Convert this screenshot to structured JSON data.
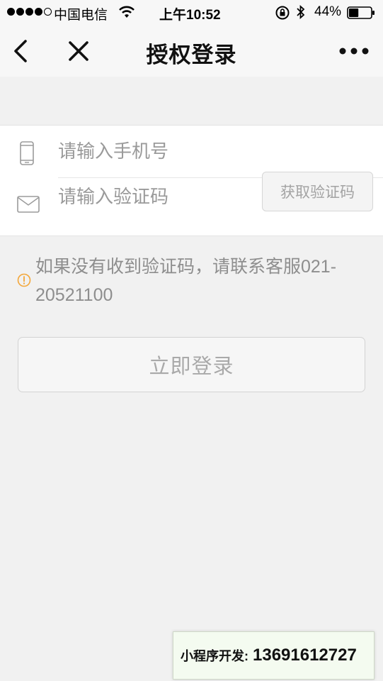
{
  "status_bar": {
    "carrier": "中国电信",
    "time": "上午10:52",
    "battery": "44%",
    "battery_level": 0.44
  },
  "nav": {
    "title": "授权登录",
    "back_icon": "chevron-left-icon",
    "close_icon": "close-icon",
    "more_icon": "more-dots-icon"
  },
  "form": {
    "phone": {
      "placeholder": "请输入手机号",
      "value": "",
      "icon": "phone-icon"
    },
    "code": {
      "placeholder": "请输入验证码",
      "value": "",
      "icon": "mail-icon"
    },
    "get_code_label": "获取验证码"
  },
  "tip": {
    "text": "如果没有收到验证码，请联系客服021-20521100",
    "icon": "warning-icon",
    "icon_color": "#f3a73a"
  },
  "login_button": {
    "label": "立即登录"
  },
  "dev_badge": {
    "label": "小程序开发:",
    "phone": "13691612727"
  }
}
